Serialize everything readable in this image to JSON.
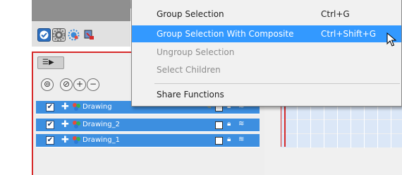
{
  "menu": {
    "items": [
      {
        "label": "Group Selection",
        "shortcut": "Ctrl+G",
        "state": "normal"
      },
      {
        "label": "Group Selection With Composite",
        "shortcut": "Ctrl+Shift+G",
        "state": "highlighted"
      },
      {
        "label": "Ungroup Selection",
        "shortcut": "",
        "state": "disabled"
      },
      {
        "label": "Select Children",
        "shortcut": "",
        "state": "disabled"
      },
      {
        "label": "Share Functions",
        "shortcut": "",
        "state": "normal"
      }
    ]
  },
  "layers": [
    {
      "name": "Drawing",
      "checked": true
    },
    {
      "name": "Drawing_2",
      "checked": true
    },
    {
      "name": "Drawing_1",
      "checked": true
    }
  ],
  "colors": {
    "menu_highlight": "#3399ff",
    "layer_selected": "#3d8fe0",
    "panel_border": "#d62a2a"
  },
  "icons": {
    "toolbar": [
      "check-circle-icon",
      "gear-icon",
      "sun-gear-icon",
      "node-icon"
    ],
    "panel_menu": "panel-menu-icon",
    "header": [
      "onion-skin-icon",
      "onion-skin-off-icon",
      "add-layer-icon",
      "remove-layer-icon"
    ],
    "cursor": "arrow-cursor-icon"
  }
}
